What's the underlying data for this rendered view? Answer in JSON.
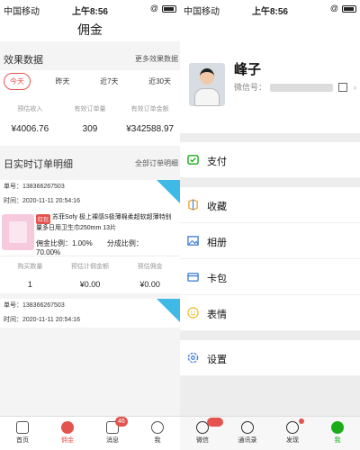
{
  "left": {
    "status": {
      "carrier": "中国移动",
      "time": "上午8:56"
    },
    "title": "佣金",
    "effect": {
      "title": "效果数据",
      "more": "更多效果数据"
    },
    "tabs": [
      "今天",
      "昨天",
      "近7天",
      "近30天"
    ],
    "active_tab": "今天",
    "stats": [
      {
        "label": "预估收入",
        "value": "¥4006.76"
      },
      {
        "label": "有效订单量",
        "value": "309"
      },
      {
        "label": "有效订单金额",
        "value": "¥342588.97"
      }
    ],
    "detail": {
      "title": "日实时订单明细",
      "more": "全部订单明细"
    },
    "orders": [
      {
        "order_no": "单号：138366267503",
        "time": "时间：2020-11-11 20:54:16",
        "tag": "红包",
        "name_line1": "苏菲Sofy 极上裸感S极薄棉柔超软超薄特别",
        "name_line2": "量多日用卫生巾250mm 13片",
        "commission_rate": "佣金比例：1.00%",
        "split_rate": "分成比例：70.00%",
        "bottom": [
          {
            "label": "购买数量",
            "value": "1"
          },
          {
            "label": "预估计佣金额",
            "value": "¥0.00"
          },
          {
            "label": "预估佣金",
            "value": "¥0.00"
          }
        ]
      },
      {
        "order_no": "单号：138366267503",
        "time": "时间：2020-11-11 20:54:16"
      }
    ],
    "nav": [
      {
        "label": "首页"
      },
      {
        "label": "佣金"
      },
      {
        "label": "消息",
        "badge": "46"
      },
      {
        "label": "我"
      }
    ]
  },
  "right": {
    "status": {
      "carrier": "中国移动",
      "time": "上午8:56"
    },
    "profile": {
      "name": "峰子",
      "wechat_id_label": "微信号："
    },
    "menu_group1": [
      {
        "label": "支付",
        "icon": "pay-icon",
        "color": "#1aad19"
      }
    ],
    "menu_group2": [
      {
        "label": "收藏",
        "icon": "favorites-icon",
        "color": "#e8a33c"
      },
      {
        "label": "相册",
        "icon": "album-icon",
        "color": "#3a7bd5"
      },
      {
        "label": "卡包",
        "icon": "card-icon",
        "color": "#3a7bd5"
      },
      {
        "label": "表情",
        "icon": "sticker-icon",
        "color": "#f1c232"
      }
    ],
    "menu_group3": [
      {
        "label": "设置",
        "icon": "settings-icon",
        "color": "#3a7bd5"
      }
    ],
    "nav": [
      {
        "label": "微信"
      },
      {
        "label": "通讯录"
      },
      {
        "label": "发现"
      },
      {
        "label": "我"
      }
    ]
  },
  "colors": {
    "accent_red": "#e4544f",
    "wechat_green": "#1aad19",
    "corner_blue": "#3fb9e6"
  }
}
